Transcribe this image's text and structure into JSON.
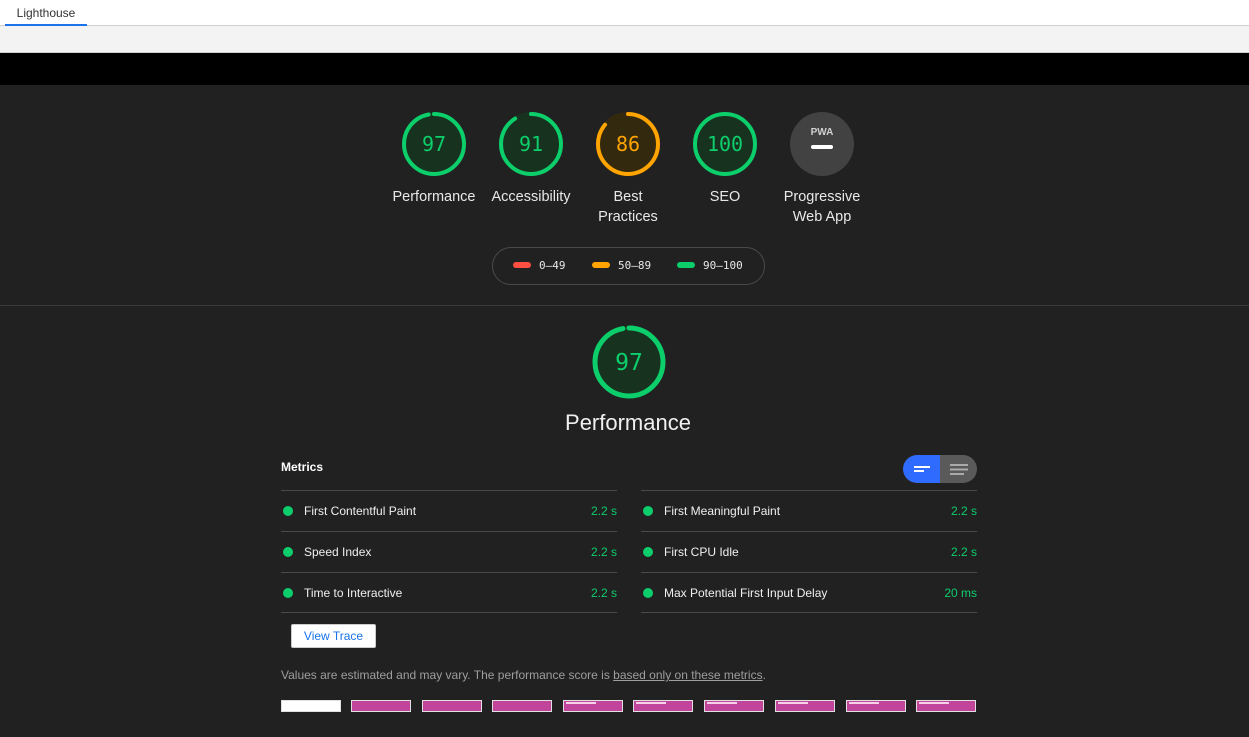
{
  "tab": {
    "label": "Lighthouse"
  },
  "colors": {
    "pass": "#0cce6b",
    "average": "#ffa400",
    "fail": "#ff4e42",
    "accent": "#2f6bff"
  },
  "categories": [
    {
      "score": "97",
      "label": "Performance",
      "status": "pass"
    },
    {
      "score": "91",
      "label": "Accessibility",
      "status": "pass"
    },
    {
      "score": "86",
      "label": "Best Practices",
      "status": "average"
    },
    {
      "score": "100",
      "label": "SEO",
      "status": "pass"
    },
    {
      "score": "PWA",
      "label": "Progressive Web App",
      "status": "na"
    }
  ],
  "legend": [
    {
      "range": "0–49"
    },
    {
      "range": "50–89"
    },
    {
      "range": "90–100"
    }
  ],
  "performance": {
    "score": "97",
    "title": "Performance"
  },
  "metrics": {
    "title": "Metrics",
    "left": [
      {
        "name": "First Contentful Paint",
        "value": "2.2 s"
      },
      {
        "name": "Speed Index",
        "value": "2.2 s"
      },
      {
        "name": "Time to Interactive",
        "value": "2.2 s"
      }
    ],
    "right": [
      {
        "name": "First Meaningful Paint",
        "value": "2.2 s"
      },
      {
        "name": "First CPU Idle",
        "value": "2.2 s"
      },
      {
        "name": "Max Potential First Input Delay",
        "value": "20 ms"
      }
    ]
  },
  "view_trace_label": "View Trace",
  "note": {
    "prefix": "Values are estimated and may vary. The performance score is ",
    "link": "based only on these metrics",
    "suffix": "."
  }
}
